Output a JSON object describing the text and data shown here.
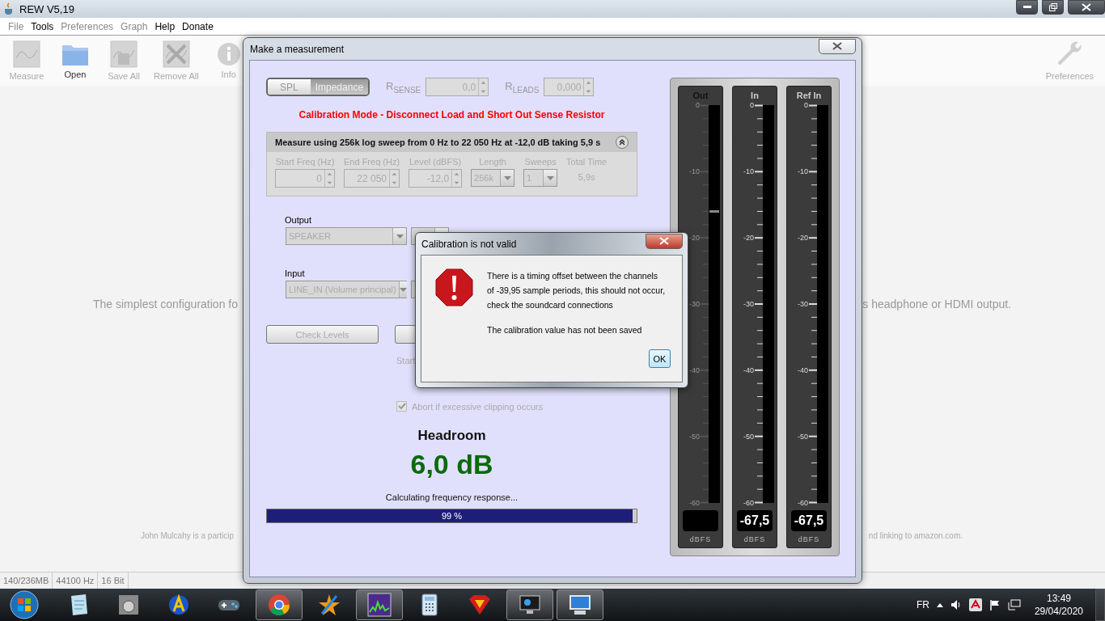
{
  "app_window": {
    "title": "REW V5,19"
  },
  "menu": [
    {
      "label": "File",
      "disabled": true
    },
    {
      "label": "Tools",
      "disabled": false
    },
    {
      "label": "Preferences",
      "disabled": true
    },
    {
      "label": "Graph",
      "disabled": true
    },
    {
      "label": "Help",
      "disabled": false
    },
    {
      "label": "Donate",
      "disabled": false
    }
  ],
  "toolbar": [
    {
      "kind": "measure",
      "label": "Measure",
      "disabled": true
    },
    {
      "kind": "open",
      "label": "Open",
      "disabled": false
    },
    {
      "kind": "save",
      "label": "Save All",
      "disabled": true
    },
    {
      "kind": "remove",
      "label": "Remove All",
      "disabled": true
    },
    {
      "kind": "info",
      "label": "Info",
      "disabled": true
    }
  ],
  "toolbar_right": {
    "kind": "preferences",
    "label": "Preferences",
    "disabled": true
  },
  "background_text": {
    "intro_left": "The simplest configuration fo",
    "intro_right": "s headphone or HDMI output.",
    "footer_left": "John Mulcahy is a particip",
    "footer_right": "nd linking to amazon.com."
  },
  "status_bar": [
    "140/236MB",
    "44100 Hz",
    "16 Bit"
  ],
  "measure_dialog": {
    "title": "Make a measurement",
    "modes": [
      {
        "label": "SPL",
        "selected": false
      },
      {
        "label": "Impedance",
        "selected": true
      }
    ],
    "r_sense": {
      "label": "R$_{SENSE}$",
      "value": "0,0"
    },
    "r_leads": {
      "label": "R$_{LEADS}$",
      "value": "0,000"
    },
    "calibration_note": "Calibration Mode - Disconnect Load and Short Out Sense Resistor",
    "sweep": {
      "summary": "Measure using 256k log sweep from 0 Hz to 22 050 Hz at -12,0 dB taking 5,9 s",
      "expanded": true,
      "fields": [
        {
          "kind": "spinner",
          "label": "Start Freq (Hz)",
          "value": "0"
        },
        {
          "kind": "spinner",
          "label": "End Freq (Hz)",
          "value": "22 050"
        },
        {
          "kind": "spinner",
          "label": "Level (dBFS)",
          "value": "-12,0"
        },
        {
          "kind": "combo",
          "label": "Length",
          "value": "256k"
        },
        {
          "kind": "combo",
          "label": "Sweeps",
          "value": "1"
        },
        {
          "kind": "text",
          "label": "Total Time",
          "value": "5,9s"
        }
      ]
    },
    "output": {
      "label": "Output",
      "device": "SPEAKER"
    },
    "input": {
      "label": "Input",
      "device": "LINE_IN (Volume principal)"
    },
    "check_levels": "Check Levels",
    "start_hint": "Start",
    "abort_clipping": {
      "label": "Abort if excessive clipping occurs",
      "checked": true
    },
    "headroom_label": "Headroom",
    "headroom_value": "6,0 dB",
    "progress_caption": "Calculating frequency response...",
    "progress": {
      "level": 0.99,
      "text": "99 %"
    },
    "meters": [
      {
        "label": "Out",
        "dimmed": true,
        "level": 0.73,
        "scale": [
          "0",
          "-10",
          "-20",
          "-30",
          "-40",
          "-50",
          "-60"
        ],
        "unit": "dBFS"
      },
      {
        "label": "In",
        "dimmed": false,
        "reading": "-67,5",
        "scale": [
          "0",
          "-10",
          "-20",
          "-30",
          "-40",
          "-50",
          "-60"
        ],
        "unit": "dBFS"
      },
      {
        "label": "Ref In",
        "dimmed": false,
        "reading": "-67,5",
        "scale": [
          "0",
          "-10",
          "-20",
          "-30",
          "-40",
          "-50",
          "-60"
        ],
        "unit": "dBFS"
      }
    ]
  },
  "error_dialog": {
    "title": "Calibration is not valid",
    "message": [
      "There is a timing offset between the channels",
      "of -39,95 sample periods, this should not occur,",
      "check the soundcard connections"
    ],
    "note": "The calibration value has not been saved",
    "ok": "OK"
  },
  "taskbar": {
    "items": [
      {
        "kind": "notepad",
        "running": false
      },
      {
        "kind": "device",
        "running": false
      },
      {
        "kind": "letter-a",
        "running": false
      },
      {
        "kind": "gamepad",
        "running": false
      },
      {
        "kind": "browser",
        "running": true
      },
      {
        "kind": "star",
        "running": false
      },
      {
        "kind": "waveform",
        "running": true
      },
      {
        "kind": "calculator",
        "running": false
      },
      {
        "kind": "shield",
        "running": false
      },
      {
        "kind": "monitor",
        "running": true
      },
      {
        "kind": "computer",
        "running": true
      }
    ],
    "language": "FR",
    "time": "13:49",
    "date": "29/04/2020"
  }
}
